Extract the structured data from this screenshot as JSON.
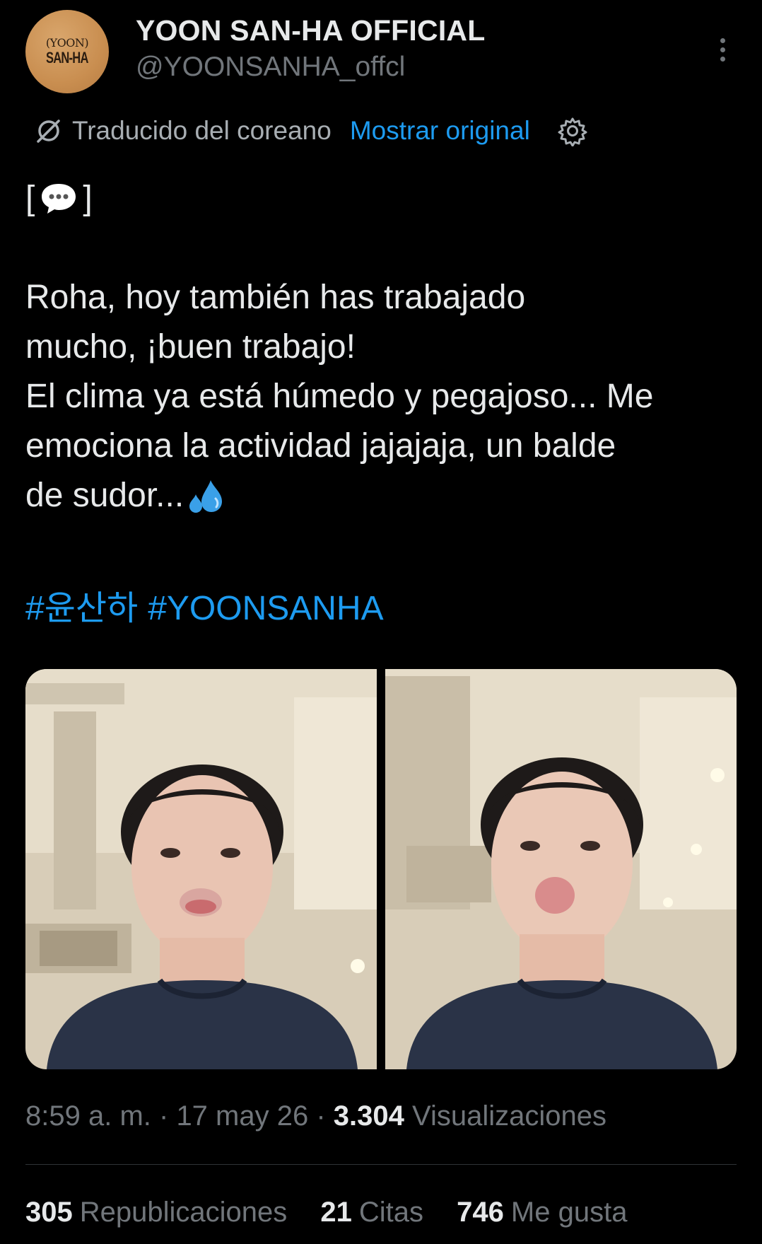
{
  "account": {
    "display_name": "YOON SAN-HA OFFICIAL",
    "handle": "@YOONSANHA_offcl",
    "avatar_line1": "(YOON)",
    "avatar_line2": "SAN-HA"
  },
  "translation": {
    "label": "Traducido del coreano",
    "show_original": "Mostrar original"
  },
  "tweet": {
    "lines": [
      "Roha, hoy también has trabajado",
      "mucho, ¡buen trabajo!",
      "El clima ya está húmedo y pegajoso... Me",
      "emociona la actividad jajajaja, un balde",
      "de sudor..."
    ],
    "hashtags": [
      "#윤산하",
      "#YOONSANHA"
    ]
  },
  "media": {
    "count": 2,
    "photo_labels": [
      "photo-1",
      "photo-2"
    ]
  },
  "meta": {
    "time": "8:59 a. m.",
    "date": "17 may 26",
    "views_count": "3.304",
    "views_label": "Visualizaciones"
  },
  "stats": {
    "reposts_count": "305",
    "reposts_label": "Republicaciones",
    "quotes_count": "21",
    "quotes_label": "Citas",
    "likes_count": "746",
    "likes_label": "Me gusta"
  },
  "colors": {
    "background": "#000000",
    "text": "#e7e9ea",
    "muted": "#71767b",
    "link": "#1d9bf0",
    "avatar": "#c98e50"
  },
  "icons": [
    "more-icon",
    "translate-icon",
    "settings-icon",
    "speech-bubble-icon",
    "sweat-droplets-icon"
  ]
}
